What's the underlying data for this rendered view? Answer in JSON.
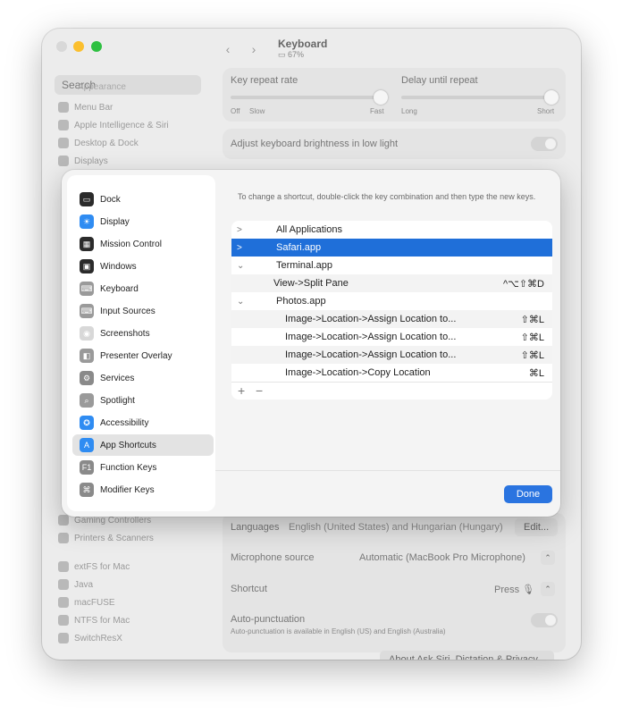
{
  "window": {
    "title": "Keyboard",
    "battery": "67%"
  },
  "background": {
    "search_placeholder": "Search",
    "search_overlap": "Appearance",
    "sidebar_items_top": [
      "Menu Bar",
      "Apple Intelligence & Siri",
      "Desktop & Dock",
      "Displays"
    ],
    "sidebar_items_bottom": [
      "Gaming Controllers",
      "Printers & Scanners",
      "extFS for Mac",
      "Java",
      "macFUSE",
      "NTFS for Mac",
      "SwitchResX"
    ],
    "key_repeat_rate": "Key repeat rate",
    "delay_until_repeat": "Delay until repeat",
    "off": "Off",
    "slow": "Slow",
    "fast": "Fast",
    "long": "Long",
    "short": "Short",
    "adjust_brightness": "Adjust keyboard brightness in low light",
    "languages_label": "Languages",
    "languages_value": "English (United States) and Hungarian (Hungary)",
    "edit_button": "Edit...",
    "mic_label": "Microphone source",
    "mic_value": "Automatic (MacBook Pro Microphone)",
    "shortcut_label": "Shortcut",
    "shortcut_value": "Press 🎙",
    "autopunct_label": "Auto-punctuation",
    "autopunct_sub": "Auto-punctuation is available in English (US) and English (Australia)",
    "about_button": "About Ask Siri, Dictation & Privacy..."
  },
  "sheet": {
    "sidebar": [
      {
        "label": "Dock",
        "icon": "dock-icon",
        "color": "#2b2b2b",
        "glyph": "▭"
      },
      {
        "label": "Display",
        "icon": "display-icon",
        "color": "#2f8cf2",
        "glyph": "☀"
      },
      {
        "label": "Mission Control",
        "icon": "mission-control-icon",
        "color": "#2b2b2b",
        "glyph": "▦"
      },
      {
        "label": "Windows",
        "icon": "windows-icon",
        "color": "#2b2b2b",
        "glyph": "▣"
      },
      {
        "label": "Keyboard",
        "icon": "keyboard-icon",
        "color": "#9a9a9a",
        "glyph": "⌨"
      },
      {
        "label": "Input Sources",
        "icon": "input-sources-icon",
        "color": "#9a9a9a",
        "glyph": "⌨"
      },
      {
        "label": "Screenshots",
        "icon": "screenshots-icon",
        "color": "#d8d8d8",
        "glyph": "◉"
      },
      {
        "label": "Presenter Overlay",
        "icon": "presenter-overlay-icon",
        "color": "#9a9a9a",
        "glyph": "◧"
      },
      {
        "label": "Services",
        "icon": "services-icon",
        "color": "#8a8a8a",
        "glyph": "⚙"
      },
      {
        "label": "Spotlight",
        "icon": "spotlight-icon",
        "color": "#9a9a9a",
        "glyph": "⌕"
      },
      {
        "label": "Accessibility",
        "icon": "accessibility-icon",
        "color": "#2f8cf2",
        "glyph": "✪"
      },
      {
        "label": "App Shortcuts",
        "icon": "app-shortcuts-icon",
        "color": "#2f8cf2",
        "glyph": "A"
      },
      {
        "label": "Function Keys",
        "icon": "function-keys-icon",
        "color": "#8a8a8a",
        "glyph": "F1"
      },
      {
        "label": "Modifier Keys",
        "icon": "modifier-keys-icon",
        "color": "#8a8a8a",
        "glyph": "⌘"
      }
    ],
    "active_index": 11,
    "description": "To change a shortcut, double-click the key combination and then type the new keys.",
    "rows": [
      {
        "chevron": ">",
        "name": "All Applications",
        "keys": "",
        "level": 0
      },
      {
        "chevron": ">",
        "name": "Safari.app",
        "keys": "",
        "level": 0,
        "selected": true
      },
      {
        "chevron": "⌄",
        "name": "Terminal.app",
        "keys": "",
        "level": 0
      },
      {
        "chevron": "",
        "name": "View->Split Pane",
        "keys": "^⌥⇧⌘D",
        "level": 1
      },
      {
        "chevron": "⌄",
        "name": "Photos.app",
        "keys": "",
        "level": 0
      },
      {
        "chevron": "",
        "name": "Image->Location->Assign Location to...",
        "keys": "⇧⌘L",
        "level": 2
      },
      {
        "chevron": "",
        "name": "Image->Location->Assign Location to...",
        "keys": "⇧⌘L",
        "level": 2
      },
      {
        "chevron": "",
        "name": "Image->Location->Assign Location to...",
        "keys": "⇧⌘L",
        "level": 2
      },
      {
        "chevron": "",
        "name": "Image->Location->Copy Location",
        "keys": "⌘L",
        "level": 2
      }
    ],
    "add_label": "+",
    "remove_label": "−",
    "done_label": "Done"
  }
}
